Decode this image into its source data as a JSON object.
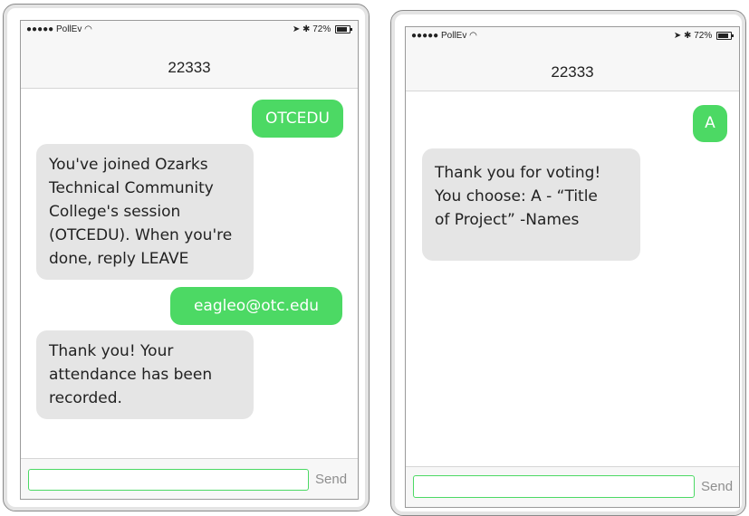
{
  "left_phone": {
    "status": {
      "carrier": "●●●●● PollEv",
      "wifi_icon": "wifi-icon",
      "location_icon": "location-arrow-icon",
      "bluetooth_icon": "bluetooth-icon",
      "battery": "72%"
    },
    "conversation_title": "22333",
    "messages": [
      {
        "direction": "outgoing",
        "text": "OTCEDU"
      },
      {
        "direction": "incoming",
        "text": "You've joined Ozarks\nTechnical Community\nCollege's session\n(OTCEDU). When you're\ndone, reply LEAVE"
      },
      {
        "direction": "outgoing",
        "text": "eagleo@otc.edu"
      },
      {
        "direction": "incoming",
        "text": "Thank you! Your\nattendance has been\nrecorded."
      }
    ],
    "input": {
      "value": ""
    },
    "send_label": "Send"
  },
  "right_phone": {
    "status": {
      "carrier": "●●●●● PollEv",
      "wifi_icon": "wifi-icon",
      "location_icon": "location-arrow-icon",
      "bluetooth_icon": "bluetooth-icon",
      "battery": "72%"
    },
    "conversation_title": "22333",
    "messages": [
      {
        "direction": "outgoing",
        "text": "A"
      },
      {
        "direction": "incoming",
        "text": "Thank you for voting!\nYou choose: A - “Title\nof Project” -Names"
      }
    ],
    "input": {
      "value": ""
    },
    "send_label": "Send"
  },
  "colors": {
    "outgoing_bubble": "#4cd964",
    "incoming_bubble": "#e5e5e5",
    "input_border": "#4cd964"
  }
}
